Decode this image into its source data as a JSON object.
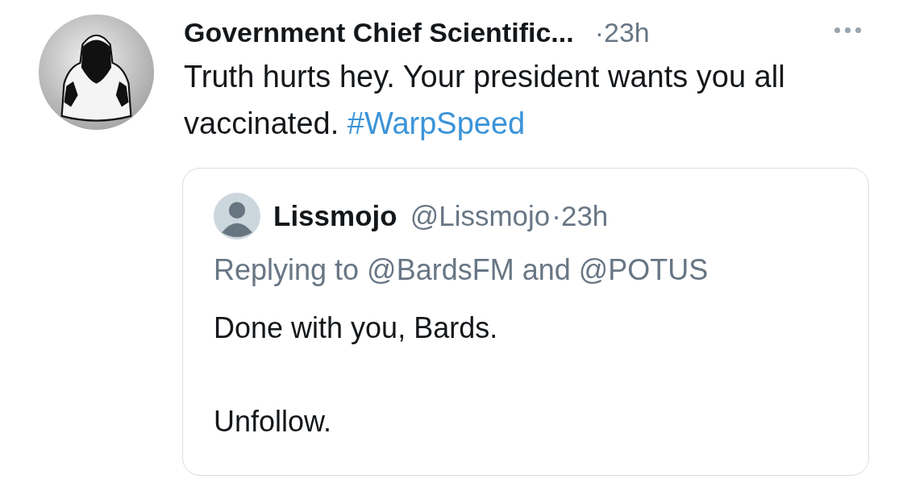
{
  "tweet": {
    "author_name": "Government Chief Scientific...",
    "time": "·23h",
    "text": "Truth hurts hey. Your president wants you all vaccinated.",
    "hashtag": "#WarpSpeed",
    "quote": {
      "author_name": "Lissmojo",
      "handle": "@Lissmojo",
      "time": "·23h",
      "replying": "Replying to @BardsFM and @POTUS",
      "paragraphs": [
        "Done with you, Bards.",
        "Unfollow."
      ]
    }
  }
}
